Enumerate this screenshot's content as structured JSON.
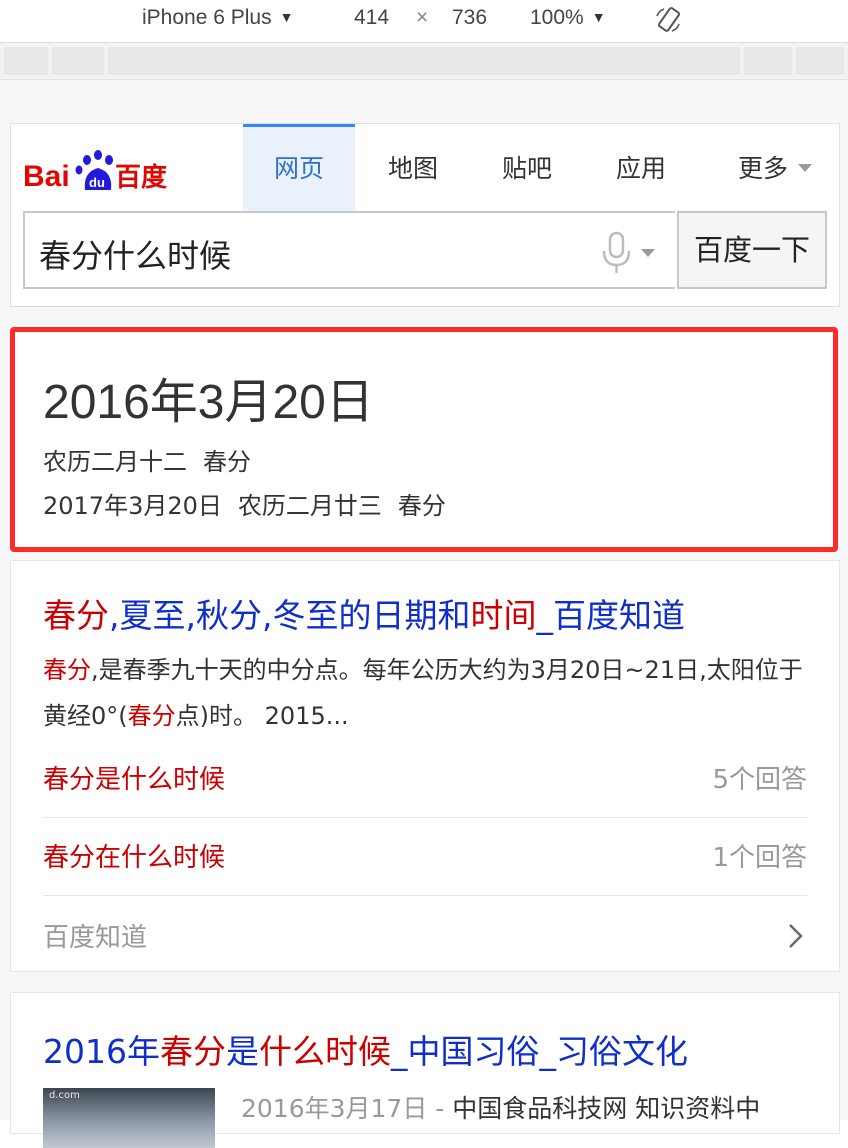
{
  "devtools": {
    "device": "iPhone 6 Plus",
    "width": "414",
    "times": "×",
    "height": "736",
    "zoom": "100%"
  },
  "header": {
    "logo_text_bai": "Bai",
    "logo_text_du": "du",
    "logo_text_cn": "百度",
    "tabs": [
      {
        "label": "网页",
        "active": true
      },
      {
        "label": "地图"
      },
      {
        "label": "贴吧"
      },
      {
        "label": "应用"
      },
      {
        "label": "更多"
      }
    ],
    "search_query": "春分什么时候",
    "search_button": "百度一下"
  },
  "answer": {
    "main_date": "2016年3月20日",
    "lunar": "农历二月十二",
    "term": "春分",
    "next_date": "2017年3月20日",
    "next_lunar": "农历二月廿三",
    "next_term": "春分"
  },
  "result1": {
    "title_parts": [
      "春分",
      ",夏至,秋分,冬至的日期和",
      "时间",
      "_百度知道"
    ],
    "abstract_hl1": "春分",
    "abstract_1": ",是春季九十天的中分点。每年公历大约为3月20日~21日,太阳位于黄经0°(",
    "abstract_hl2": "春分",
    "abstract_2": "点)时。 2015...",
    "questions": [
      {
        "hl": "春分",
        "rest": "是",
        "hl2": "什么时候",
        "count": "5个回答"
      },
      {
        "hl": "春分",
        "rest": "在",
        "hl2": "什么时候",
        "count": "1个回答"
      }
    ],
    "source": "百度知道"
  },
  "result2": {
    "title_parts": [
      "2016年",
      "春分",
      "是",
      "什么时候",
      "_中国习俗_习俗文化"
    ],
    "date": "2016年3月17日 -",
    "site_text": "中国食品科技网 知识资料中",
    "thumb_watermark": "d.com"
  },
  "colors": {
    "highlight_border": "#ff2b2b",
    "link_blue": "#0f2fc8",
    "hl_red": "#cc0000",
    "tab_active": "#3385ff"
  }
}
